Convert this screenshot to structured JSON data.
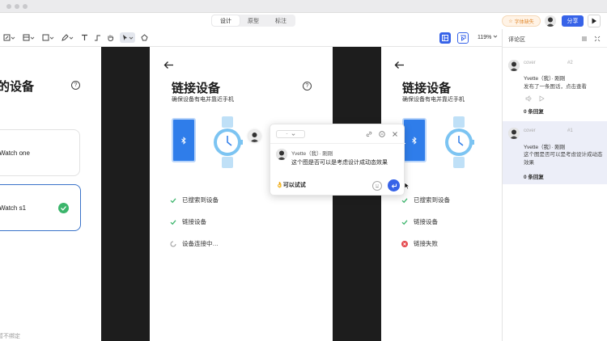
{
  "header": {
    "modes": [
      {
        "label": "设计",
        "active": true
      },
      {
        "label": "原型",
        "active": false
      },
      {
        "label": "标注",
        "active": false
      }
    ],
    "favorite_label": "字体缺失",
    "share_label": "分享"
  },
  "toolbar": {
    "zoom": "119%"
  },
  "canvas": {
    "frame1": {
      "title": "的设备",
      "help_glyph": "?",
      "card1_label": "Watch one",
      "card2_label": "Watch s1",
      "footer_text": "暂不绑定"
    },
    "frame2": {
      "title": "链接设备",
      "subtitle": "确保设备有电并靠近手机",
      "help_glyph": "?",
      "steps": [
        {
          "label": "已搜索到设备",
          "status": "done"
        },
        {
          "label": "链接设备",
          "status": "done"
        },
        {
          "label": "设备连接中…",
          "status": "loading"
        }
      ]
    },
    "frame3": {
      "title": "链接设备",
      "subtitle": "确保设备有电并靠近手机",
      "steps": [
        {
          "label": "已搜索到设备",
          "status": "done"
        },
        {
          "label": "链接设备",
          "status": "done"
        },
        {
          "label": "链接失败",
          "status": "failed"
        }
      ]
    }
  },
  "popup": {
    "select_value": "-",
    "user": "Yvette（我）· 刚刚",
    "text": "这个图是否可以是考虑设计成动态效果",
    "input_value": "👌可以试试"
  },
  "panel": {
    "title": "评论区",
    "comments": [
      {
        "cover": "cover",
        "number": "#2",
        "user": "Yvette（我）· 刚刚",
        "text": "发布了一条图话，点击查看",
        "replies": "0 条回复",
        "highlighted": false
      },
      {
        "cover": "cover",
        "number": "#1",
        "user": "Yvette（我）· 刚刚",
        "text": "这个图是否可以是考虑设计成动态效果",
        "replies": "0 条回复",
        "highlighted": true
      }
    ]
  },
  "colors": {
    "accent": "#3763e8",
    "success": "#3bb56b",
    "error": "#e5484d",
    "phone": "#2f7dea",
    "watch": "#7cc4f2"
  }
}
